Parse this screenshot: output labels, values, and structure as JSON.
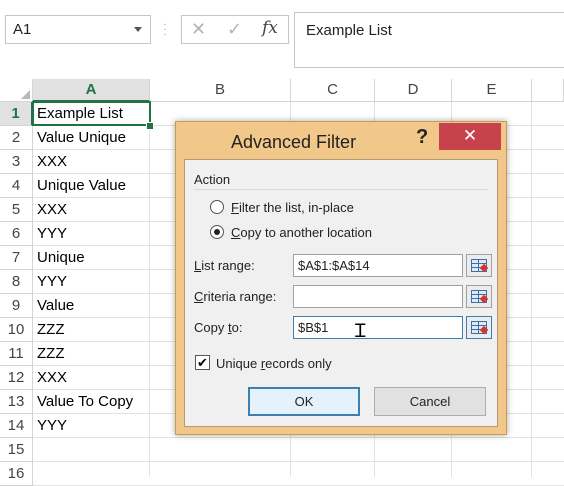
{
  "name_box": {
    "value": "A1",
    "dropdown_icon": "chevron-down-icon"
  },
  "formula_bar": {
    "cancel_icon": "✕",
    "enter_icon": "✓",
    "fx_label": "fx",
    "content": "Example List"
  },
  "columns": [
    "A",
    "B",
    "C",
    "D",
    "E"
  ],
  "rows": [
    "1",
    "2",
    "3",
    "4",
    "5",
    "6",
    "7",
    "8",
    "9",
    "10",
    "11",
    "12",
    "13",
    "14",
    "15",
    "16"
  ],
  "cells_a": [
    "Example List",
    "Value Unique",
    "XXX",
    "Unique Value",
    "XXX",
    "YYY",
    "Unique",
    "YYY",
    "Value",
    "ZZZ",
    "ZZZ",
    "XXX",
    "Value To Copy",
    "YYY",
    "",
    ""
  ],
  "selected": {
    "column": "A",
    "row": "1"
  },
  "dialog": {
    "title": "Advanced Filter",
    "help_label": "?",
    "close_label": "✕",
    "action_label": "Action",
    "radio_filter": {
      "pre": "",
      "key": "F",
      "post": "ilter the list, in-place",
      "checked": false
    },
    "radio_copy": {
      "pre": "",
      "key": "C",
      "post": "opy to another location",
      "checked": true
    },
    "list_range": {
      "pre": "",
      "key": "L",
      "post": "ist range:",
      "value": "$A$1:$A$14"
    },
    "criteria_range": {
      "pre": "",
      "key": "C",
      "post": "riteria range:",
      "value": ""
    },
    "copy_to": {
      "pre": "Copy ",
      "key": "t",
      "post": "o:",
      "value": "$B$1"
    },
    "unique_records": {
      "pre": "Unique ",
      "key": "r",
      "post": "ecords only",
      "checked": true,
      "check_glyph": "✔"
    },
    "ok_label": "OK",
    "cancel_label": "Cancel"
  },
  "colors": {
    "accent_green": "#217346",
    "dialog_frame": "#f2c88a",
    "close_red": "#c7434b"
  }
}
